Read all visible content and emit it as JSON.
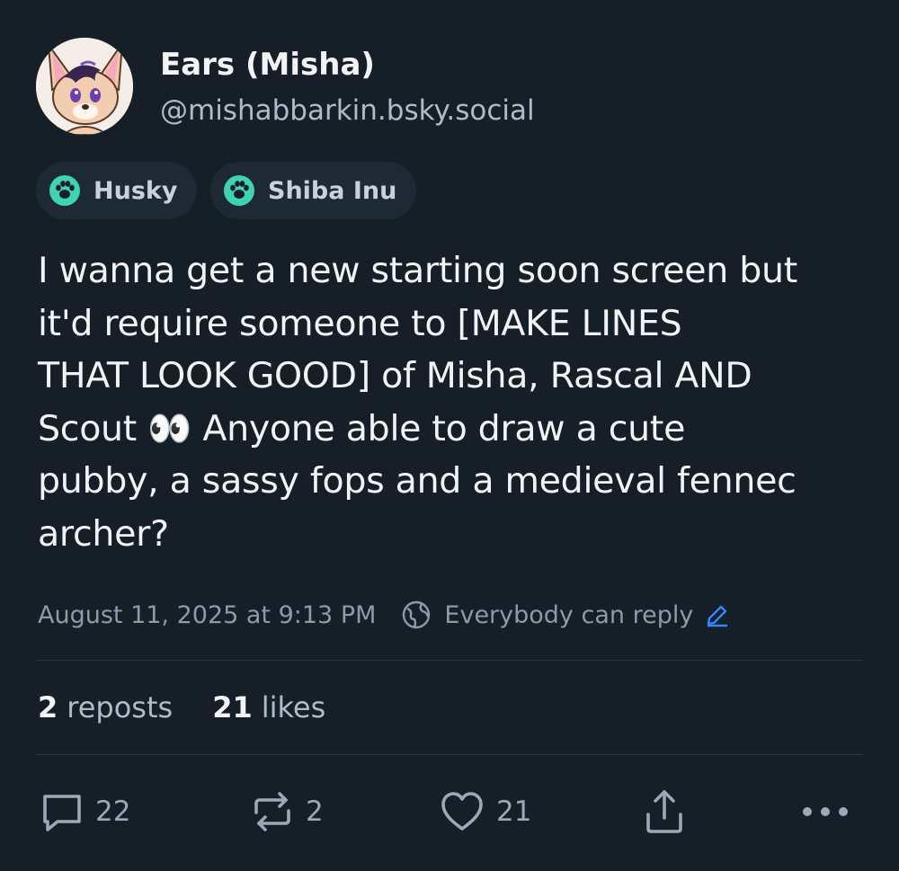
{
  "author": {
    "display_name": "Ears (Misha)",
    "handle": "@mishabbarkin.bsky.social",
    "avatar_icon": "fennec-avatar-icon"
  },
  "tags": [
    {
      "label": "Husky",
      "icon": "paw-icon"
    },
    {
      "label": "Shiba Inu",
      "icon": "paw-icon"
    }
  ],
  "post": {
    "text": "I wanna get a new starting soon screen but\nit'd require someone to [MAKE LINES\nTHAT LOOK GOOD] of Misha, Rascal AND\nScout 👀 Anyone able to draw a cute\npubby, a sassy fops and a medieval fennec\narcher?"
  },
  "meta": {
    "timestamp": "August 11, 2025 at 9:13 PM",
    "reply_setting": "Everybody can reply"
  },
  "stats": {
    "reposts_count": "2",
    "reposts_label": "reposts",
    "likes_count": "21",
    "likes_label": "likes"
  },
  "actions": {
    "reply_count": "22",
    "repost_count": "2",
    "like_count": "21"
  },
  "colors": {
    "background": "#161e27",
    "chip_background": "#1e2936",
    "paw_icon": "#3fd3b6",
    "accent_link": "#2f88ff",
    "muted_text": "#8b9bac"
  }
}
